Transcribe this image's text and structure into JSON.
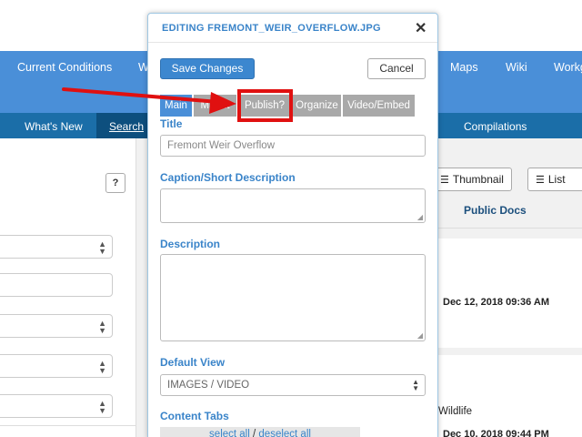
{
  "topnav": {
    "items": [
      "Current Conditions",
      "W",
      "Maps",
      "Wiki",
      "Workg"
    ]
  },
  "subnav": {
    "items": [
      "What's New",
      "Search",
      "Compilations"
    ]
  },
  "right_panel": {
    "thumbnail_label": "Thumbnail",
    "list_label": "List",
    "public_docs_label": "Public Docs",
    "date_1": "Dec 12, 2018 09:36 AM",
    "wildlife_text": "Wildlife",
    "date_2": "Dec 10, 2018 09:44 PM"
  },
  "left_panel": {
    "help_button": "?"
  },
  "modal": {
    "title": "EDITING FREMONT_WEIR_OVERFLOW.JPG",
    "save_label": "Save Changes",
    "cancel_label": "Cancel",
    "tabs": [
      "Main",
      "Map It",
      "Publish?",
      "Organize",
      "Video/Embed"
    ],
    "active_tab": "Main",
    "highlighted_tab": "Publish?",
    "fields": {
      "title_label": "Title",
      "title_value": "Fremont Weir Overflow",
      "caption_label": "Caption/Short Description",
      "description_label": "Description",
      "default_view_label": "Default View",
      "default_view_value": "IMAGES / VIDEO",
      "content_tabs_label": "Content Tabs",
      "select_all": "select all",
      "separator": "/",
      "deselect_all": "deselect all"
    }
  },
  "colors": {
    "nav_blue": "#4a8fd8",
    "subnav_blue": "#1b6ea8",
    "accent_blue": "#3a84c9",
    "highlight_red": "#e01010"
  }
}
